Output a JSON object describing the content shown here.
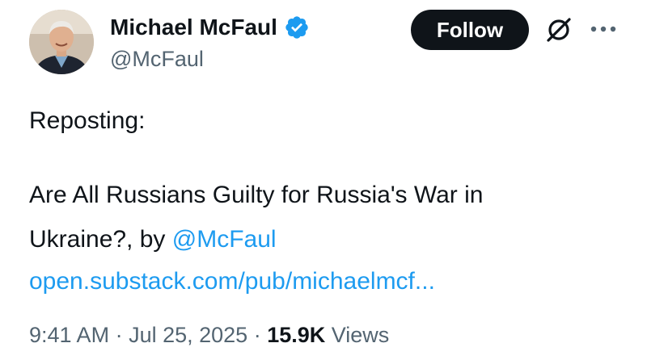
{
  "author": {
    "display_name": "Michael McFaul",
    "handle": "@McFaul",
    "verified": true
  },
  "actions": {
    "follow_label": "Follow",
    "grok_icon": "grok-slash-icon",
    "more_icon": "more-dots-icon"
  },
  "post": {
    "line1": "Reposting:",
    "line2": "Are All Russians Guilty for Russia's War in",
    "line3_text": "Ukraine?, by ",
    "mention": "@McFaul",
    "link": "open.substack.com/pub/michaelmcf..."
  },
  "meta": {
    "time": "9:41 AM",
    "sep1": " · ",
    "date": "Jul 25, 2025",
    "sep2": " · ",
    "views_count": "15.9K",
    "views_label": " Views"
  },
  "colors": {
    "accent": "#1d9bf0",
    "text": "#0f1419",
    "secondary": "#536471",
    "button_bg": "#0f1419"
  }
}
